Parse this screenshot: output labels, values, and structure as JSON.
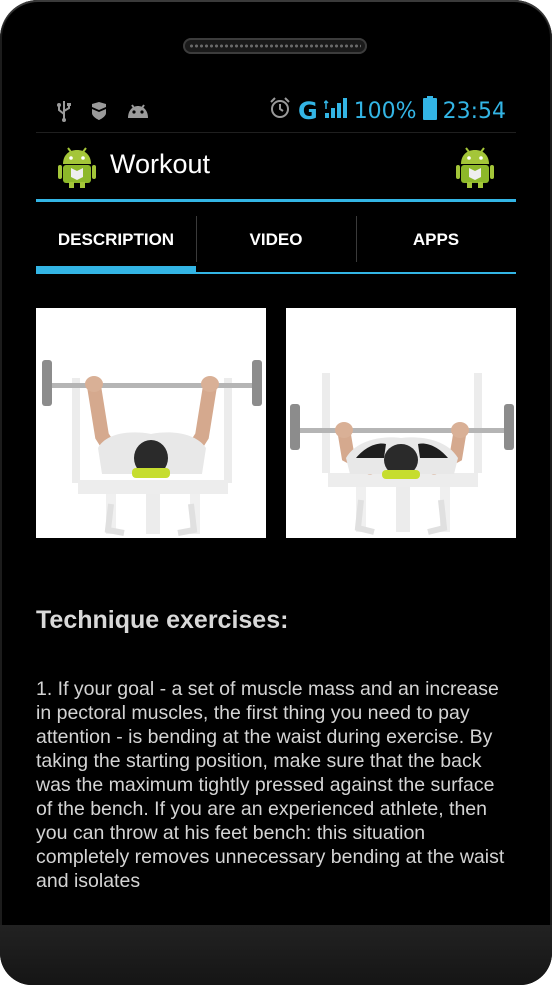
{
  "status_bar": {
    "network": "G",
    "battery": "100%",
    "time": "23:54",
    "left_icons": [
      "usb-icon",
      "shield-icon",
      "android-debug-icon"
    ],
    "right_icons": [
      "alarm-icon",
      "signal-icon",
      "battery-icon"
    ],
    "accent": "#33b5e5"
  },
  "action_bar": {
    "title": "Workout"
  },
  "tabs": [
    {
      "label": "DESCRIPTION",
      "active": true
    },
    {
      "label": "VIDEO",
      "active": false
    },
    {
      "label": "APPS",
      "active": false
    }
  ],
  "content": {
    "heading": "Technique exercises:",
    "body": "1. If your goal - a set of muscle mass and an increase in pectoral muscles, the first thing you need to pay attention - is bending at the waist during  exercise. By taking the starting position, make sure that the back was the maximum tightly pressed against the surface of the bench. If you are an experienced athlete, then you can throw at his feet bench: this situation completely removes unnecessary bending at the waist and isolates"
  }
}
